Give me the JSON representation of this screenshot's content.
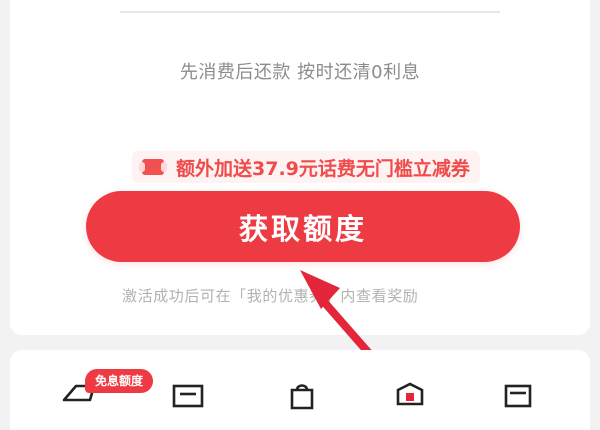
{
  "limit_card": {
    "masked_amount": {
      "digits": [
        "*",
        "*",
        "*",
        "*",
        "*"
      ]
    },
    "subtitle": "先消费后还款 按时还清0利息",
    "promo_text": "额外加送37.9元话费无门槛立减券",
    "cta_label": "获取额度",
    "hint_text": "激活成功后可在「我的优惠券」内查看奖励"
  },
  "bottom_tools": {
    "badge_label": "免息额度",
    "icons": [
      "cart-icon",
      "list-icon",
      "bag-icon",
      "coupon-card-icon",
      "calendar-icon"
    ]
  },
  "overlay": {
    "arrow_color": "#e3263a"
  },
  "theme": {
    "accent_color": "#ee3a43",
    "text_muted": "#8c8c8c",
    "card_bg": "#ffffff"
  }
}
